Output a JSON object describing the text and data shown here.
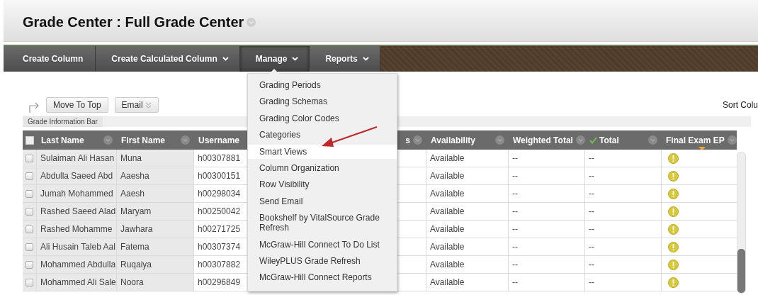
{
  "page_title": "Grade Center : Full Grade Center",
  "nav": [
    {
      "label": "Create Column",
      "dropdown": false,
      "selected": false
    },
    {
      "label": "Create Calculated Column",
      "dropdown": true,
      "selected": false
    },
    {
      "label": "Manage",
      "dropdown": true,
      "selected": true
    },
    {
      "label": "Reports",
      "dropdown": true,
      "selected": false
    }
  ],
  "manage_menu": {
    "items": [
      {
        "label": "Grading Periods",
        "selected": false
      },
      {
        "label": "Grading Schemas",
        "selected": false
      },
      {
        "label": "Grading Color Codes",
        "selected": false
      },
      {
        "label": "Categories",
        "selected": false
      },
      {
        "label": "Smart Views",
        "selected": true
      },
      {
        "label": "Column Organization",
        "selected": false
      },
      {
        "label": "Row Visibility",
        "selected": false
      },
      {
        "label": "Send Email",
        "selected": false
      },
      {
        "label": "Bookshelf by VitalSource Grade Refresh",
        "selected": false
      },
      {
        "label": "McGraw-Hill Connect To Do List",
        "selected": false
      },
      {
        "label": "WileyPLUS Grade Refresh",
        "selected": false
      },
      {
        "label": "McGraw-Hill Connect Reports",
        "selected": false
      }
    ]
  },
  "toolbar": {
    "buttons": [
      {
        "label": "Move To Top",
        "dropdown": false
      },
      {
        "label": "Email",
        "dropdown": true
      }
    ],
    "sort_label": "Sort Colu"
  },
  "info_bar": "Grade Information Bar",
  "grid": {
    "select_all_checked": false,
    "columns": [
      {
        "label": "Last Name",
        "checkmark": false,
        "sorted": false
      },
      {
        "label": "First Name",
        "checkmark": false,
        "sorted": false
      },
      {
        "label": "Username",
        "checkmark": false,
        "sorted": false
      },
      {
        "label": "s",
        "checkmark": false,
        "sorted": false
      },
      {
        "label": "Availability",
        "checkmark": false,
        "sorted": false
      },
      {
        "label": "Weighted Total",
        "checkmark": false,
        "sorted": false
      },
      {
        "label": "Total",
        "checkmark": true,
        "sorted": false
      },
      {
        "label": "Final Exam EP",
        "checkmark": false,
        "sorted": true
      }
    ],
    "rows": [
      {
        "checked": false,
        "last_name": "Sulaiman Ali Hasan",
        "first_name": "Muna",
        "username": "h00307881",
        "availability": "Available",
        "weighted_total": "--",
        "total": "--",
        "final_exam": {
          "kind": "attention"
        }
      },
      {
        "checked": false,
        "last_name": "Abdulla Saeed Abd",
        "first_name": "Aaesha",
        "username": "h00300151",
        "availability": "Available",
        "weighted_total": "--",
        "total": "--",
        "final_exam": {
          "kind": "attention"
        }
      },
      {
        "checked": false,
        "last_name": "Jumah Mohammed",
        "first_name": "Aaesh",
        "username": "h00298034",
        "availability": "Available",
        "weighted_total": "--",
        "total": "--",
        "final_exam": {
          "kind": "attention"
        }
      },
      {
        "checked": false,
        "last_name": "Rashed Saeed Alad",
        "first_name": "Maryam",
        "username": "h00250042",
        "availability": "Available",
        "weighted_total": "--",
        "total": "--",
        "final_exam": {
          "kind": "attention"
        }
      },
      {
        "checked": false,
        "last_name": "Rashed Mohamme",
        "first_name": "Jawhara",
        "username": "h00271725",
        "availability": "Available",
        "weighted_total": "--",
        "total": "--",
        "final_exam": {
          "kind": "attention"
        }
      },
      {
        "checked": false,
        "last_name": "Ali Husain Taleb Aal",
        "first_name": "Fatema",
        "username": "h00307374",
        "availability": "Available",
        "weighted_total": "--",
        "total": "--",
        "final_exam": {
          "kind": "attention"
        }
      },
      {
        "checked": false,
        "last_name": "Mohammed Abdulla",
        "first_name": "Ruqaiya",
        "username": "h00307882",
        "availability": "Available",
        "weighted_total": "--",
        "total": "--",
        "final_exam": {
          "kind": "attention"
        }
      },
      {
        "checked": false,
        "last_name": "Mohammed Ali Sale",
        "first_name": "Noora",
        "username": "h00296849",
        "availability": "Available",
        "weighted_total": "--",
        "total": "--",
        "final_exam": {
          "kind": "attention"
        }
      }
    ]
  }
}
